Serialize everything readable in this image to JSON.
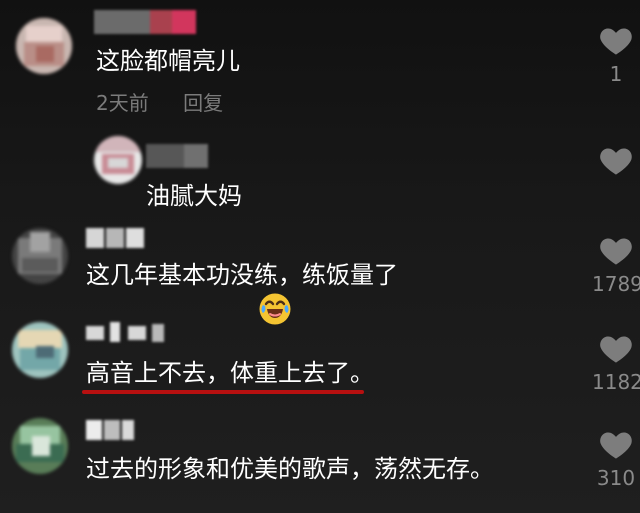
{
  "comments": [
    {
      "text": "这脸都帽亮儿",
      "time": "2天前",
      "reply": "回复",
      "likes": "1"
    },
    {
      "text": "油腻大妈",
      "likes": ""
    },
    {
      "text": "这几年基本功没练，练饭量了",
      "likes": "1789"
    },
    {
      "text": "高音上不去，体重上去了。",
      "likes": "1182"
    },
    {
      "text": "过去的形象和优美的歌声，荡然无存。",
      "likes": "310"
    }
  ],
  "icons": {
    "heart": "heart-icon",
    "emoji": "laughing-crying-emoji"
  },
  "colors": {
    "background": "#151515",
    "text": "#ffffff",
    "muted": "#7b7b7b",
    "highlight": "#b71010"
  }
}
